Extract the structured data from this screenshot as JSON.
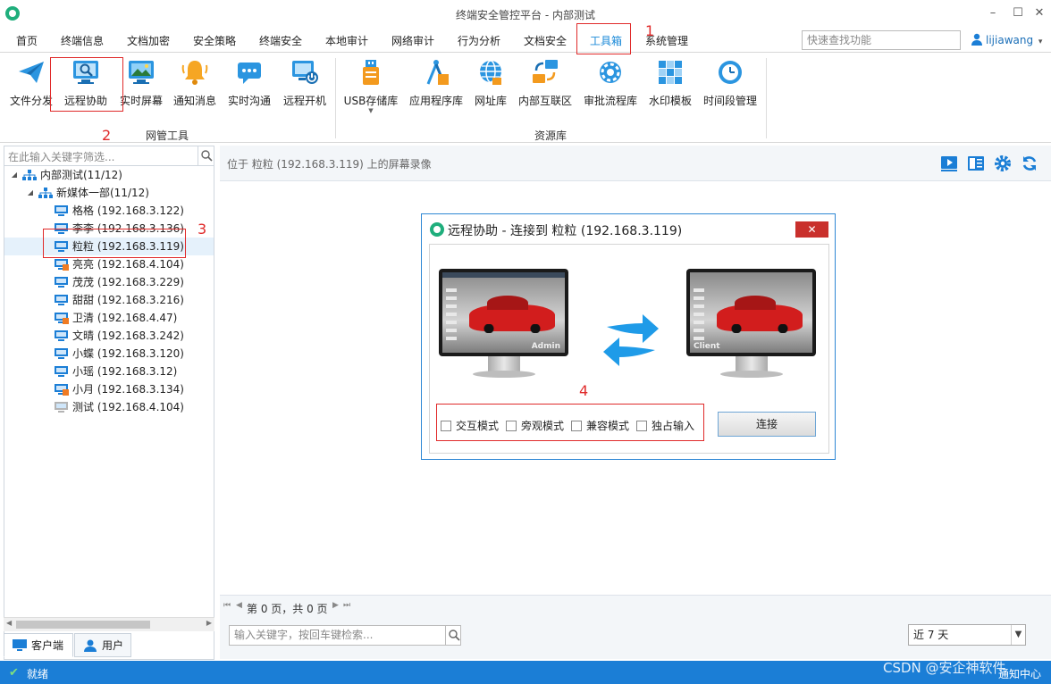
{
  "window": {
    "title": "终端安全管控平台 - 内部测试",
    "controls": [
      "–",
      "☐",
      "✕"
    ]
  },
  "menu": {
    "tabs": [
      "首页",
      "终端信息",
      "文档加密",
      "安全策略",
      "终端安全",
      "本地审计",
      "网络审计",
      "行为分析",
      "文档安全",
      "工具箱",
      "系统管理"
    ],
    "active": "工具箱",
    "search_placeholder": "快速查找功能",
    "user": "lijiawang",
    "user_caret": "▾"
  },
  "ribbon": {
    "network_tools": {
      "label": "网管工具",
      "items": [
        "文件分发",
        "远程协助",
        "实时屏幕",
        "通知消息",
        "实时沟通",
        "远程开机"
      ]
    },
    "resources": {
      "label": "资源库",
      "items": [
        "USB存储库",
        "应用程序库",
        "网址库",
        "内部互联区",
        "审批流程库",
        "水印模板",
        "时间段管理"
      ]
    }
  },
  "tree": {
    "filter_placeholder": "在此输入关键字筛选...",
    "root": "内部测试(11/12)",
    "group": "新媒体一部(11/12)",
    "nodes": [
      {
        "label": "格格 (192.168.3.122)",
        "status": "online"
      },
      {
        "label": "李李 (192.168.3.136)",
        "status": "online"
      },
      {
        "label": "粒粒 (192.168.3.119)",
        "status": "online"
      },
      {
        "label": "亮亮 (192.168.4.104)",
        "status": "alert"
      },
      {
        "label": "茂茂 (192.168.3.229)",
        "status": "online"
      },
      {
        "label": "甜甜 (192.168.3.216)",
        "status": "online"
      },
      {
        "label": "卫清 (192.168.4.47)",
        "status": "alert"
      },
      {
        "label": "文晴 (192.168.3.242)",
        "status": "online"
      },
      {
        "label": "小蝶 (192.168.3.120)",
        "status": "online"
      },
      {
        "label": "小瑶 (192.168.3.12)",
        "status": "online"
      },
      {
        "label": "小月 (192.168.3.134)",
        "status": "alert"
      },
      {
        "label": "测试 (192.168.4.104)",
        "status": "offline"
      }
    ],
    "selected": "粒粒 (192.168.3.119)"
  },
  "left_tabs": [
    "客户端",
    "用户"
  ],
  "right": {
    "header": "位于 粒粒 (192.168.3.119) 上的屏幕录像",
    "pager": "第 0 页，共 0 页",
    "keyword_placeholder": "输入关键字，按回车键检索...",
    "range": "近 7 天"
  },
  "dialog": {
    "title": "远程协助 - 连接到 粒粒 (192.168.3.119)",
    "close": "✕",
    "left_monitor_label": "Admin",
    "right_monitor_label": "Client",
    "options": [
      "交互模式",
      "旁观模式",
      "兼容模式",
      "独占输入"
    ],
    "connect": "连接"
  },
  "annotations": [
    "1",
    "2",
    "3",
    "4"
  ],
  "status": {
    "text": "就绪",
    "check": "✔",
    "notice": "通知中心",
    "watermark": "CSDN @安企神软件"
  },
  "colors": {
    "accent": "#1b7ed6",
    "annotation_red": "#e02a2a",
    "alert_orange": "#f07b23"
  }
}
